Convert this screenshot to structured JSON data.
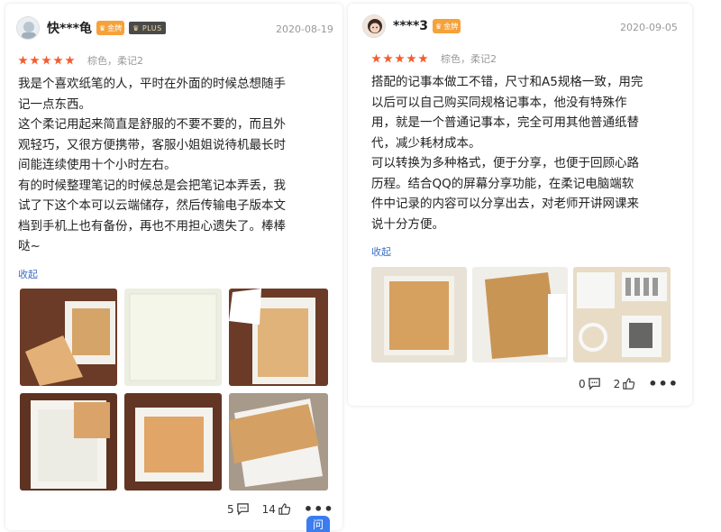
{
  "reviews": [
    {
      "username": "快***龟",
      "level_badge": "金牌",
      "plus_badge": "PLUS",
      "date": "2020-08-19",
      "stars": 5,
      "attributes": "棕色，柔记2",
      "text": "我是个喜欢纸笔的人，平时在外面的时候总想随手\n记一点东西。\n这个柔记用起来简直是舒服的不要不要的，而且外\n观轻巧，又很方便携带，客服小姐姐说待机最长时\n间能连续使用十个小时左右。\n有的时候整理笔记的时候总是会把笔记本弄丢，我\n试了下这个本可以云端储存，然后传输电子版本文\n档到手机上也有备份，再也不用担心遗失了。棒棒\n哒~",
      "collapse_label": "收起",
      "photo_count": 6,
      "comments": "5",
      "likes": "14",
      "more": "•••"
    },
    {
      "username": "****3",
      "level_badge": "金牌",
      "date": "2020-09-05",
      "stars": 5,
      "attributes": "棕色，柔记2",
      "text": "搭配的记事本做工不错，尺寸和A5规格一致，用完\n以后可以自己购买同规格记事本，他没有特殊作\n用，就是一个普通记事本，完全可用其他普通纸替\n代，减少耗材成本。\n可以转换为多种格式，便于分享，也便于回顾心路\n历程。结合QQ的屏幕分享功能，在柔记电脑端软\n件中记录的内容可以分享出去，对老师开讲网课来\n说十分方便。",
      "collapse_label": "收起",
      "photo_count": 3,
      "comments": "0",
      "likes": "2",
      "more": "•••"
    }
  ],
  "float_button": "问",
  "colors": {
    "star": "#f25c2e",
    "link": "#3b6fc4",
    "badge": "#f6a23a",
    "float": "#3b7cf0"
  },
  "icons": [
    "avatar",
    "comment-icon",
    "thumbs-up-icon",
    "more-icon"
  ]
}
